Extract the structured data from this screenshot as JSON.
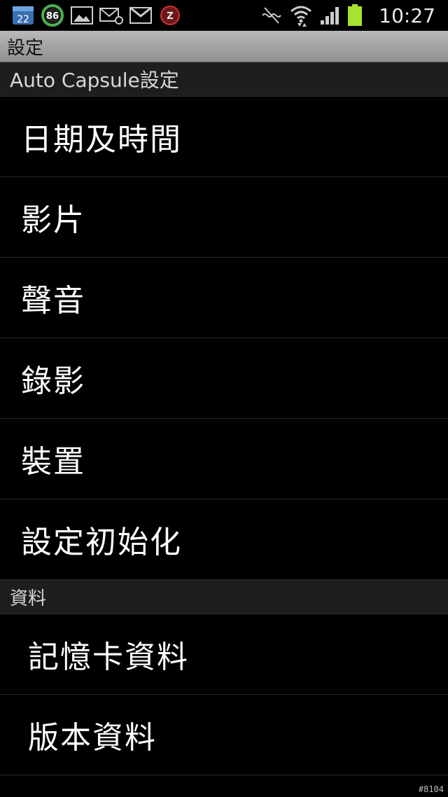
{
  "status_bar": {
    "calendar_day": "22",
    "battery_level": "86",
    "time": "10:27",
    "icons": [
      "calendar-icon",
      "battery-saver-icon",
      "gallery-icon",
      "email-icon",
      "gmail-icon",
      "z-app-icon",
      "mute-icon",
      "wifi-icon",
      "signal-icon",
      "battery-icon"
    ],
    "battery_color": "#a6e22e"
  },
  "title_bar": {
    "title": "設定"
  },
  "sections": {
    "auto_capsule": {
      "label": "Auto  Capsule設定",
      "items": [
        {
          "label": "日期及時間"
        },
        {
          "label": "影片"
        },
        {
          "label": "聲音"
        },
        {
          "label": "錄影"
        },
        {
          "label": "裝置"
        },
        {
          "label": "設定初始化"
        }
      ]
    },
    "data": {
      "label": "資料",
      "items": [
        {
          "label": "記憶卡資料"
        },
        {
          "label": "版本資料"
        }
      ]
    }
  },
  "watermark": "#8104"
}
